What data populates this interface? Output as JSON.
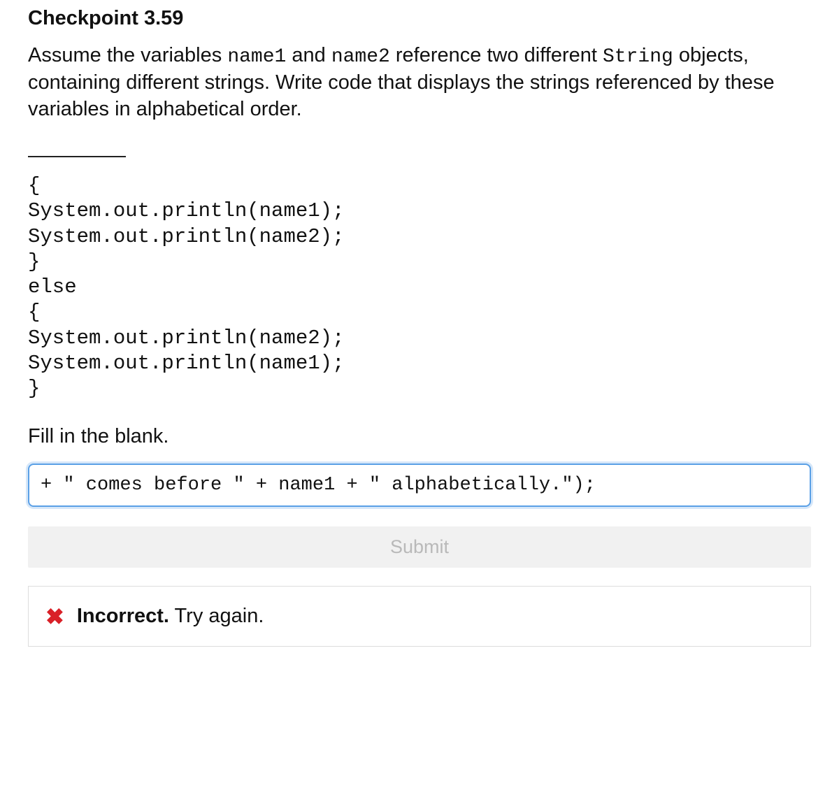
{
  "title": "Checkpoint 3.59",
  "prompt": {
    "pre1": "Assume the variables ",
    "var1": "name1",
    "mid1": " and ",
    "var2": "name2",
    "mid2": " reference two different ",
    "type": "String",
    "post": " objects, containing different strings. Write code that displays the strings referenced by these variables in alphabetical order."
  },
  "code": {
    "l2": "{",
    "l3": "System.out.println(name1);",
    "l4": "System.out.println(name2);",
    "l5": "}",
    "l6": "else",
    "l7": "{",
    "l8": "System.out.println(name2);",
    "l9": "System.out.println(name1);",
    "l10": "}"
  },
  "fill_label": "Fill in the blank.",
  "answer_value": "+ \" comes before \" + name1 + \" alphabetically.\");",
  "submit_label": "Submit",
  "feedback": {
    "icon": "✖",
    "strong": "Incorrect.",
    "rest": " Try again."
  }
}
